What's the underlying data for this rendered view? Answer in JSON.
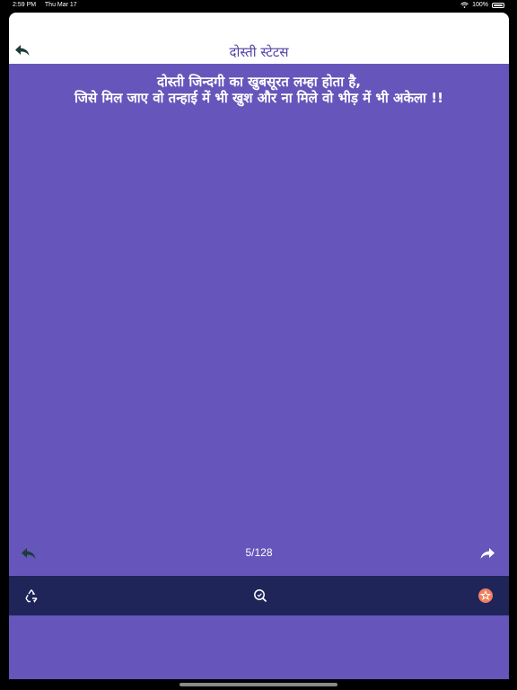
{
  "status_bar": {
    "time": "2:59 PM",
    "date": "Thu Mar 17",
    "battery": "100%"
  },
  "nav": {
    "title": "दोस्ती स्टेटस",
    "back_icon": "reply-arrow-icon"
  },
  "quote": {
    "line1": "दोस्ती जिन्दगी का खुबसूरत लम्हा होता है,",
    "line2": "जिसे मिल जाए वो तन्हाई में भी खुश और ना मिले वो भीड़ में भी अकेला !!"
  },
  "pager": {
    "counter": "5/128",
    "prev_icon": "previous-arrow-icon",
    "next_icon": "next-arrow-icon"
  },
  "toolbar": {
    "left_icon": "recycle-icon",
    "center_icon": "search-icon",
    "right_icon": "star-icon"
  },
  "colors": {
    "background": "#6655bb",
    "toolbar": "#1f2559",
    "title": "#5543a8",
    "star_badge": "#f08060"
  }
}
